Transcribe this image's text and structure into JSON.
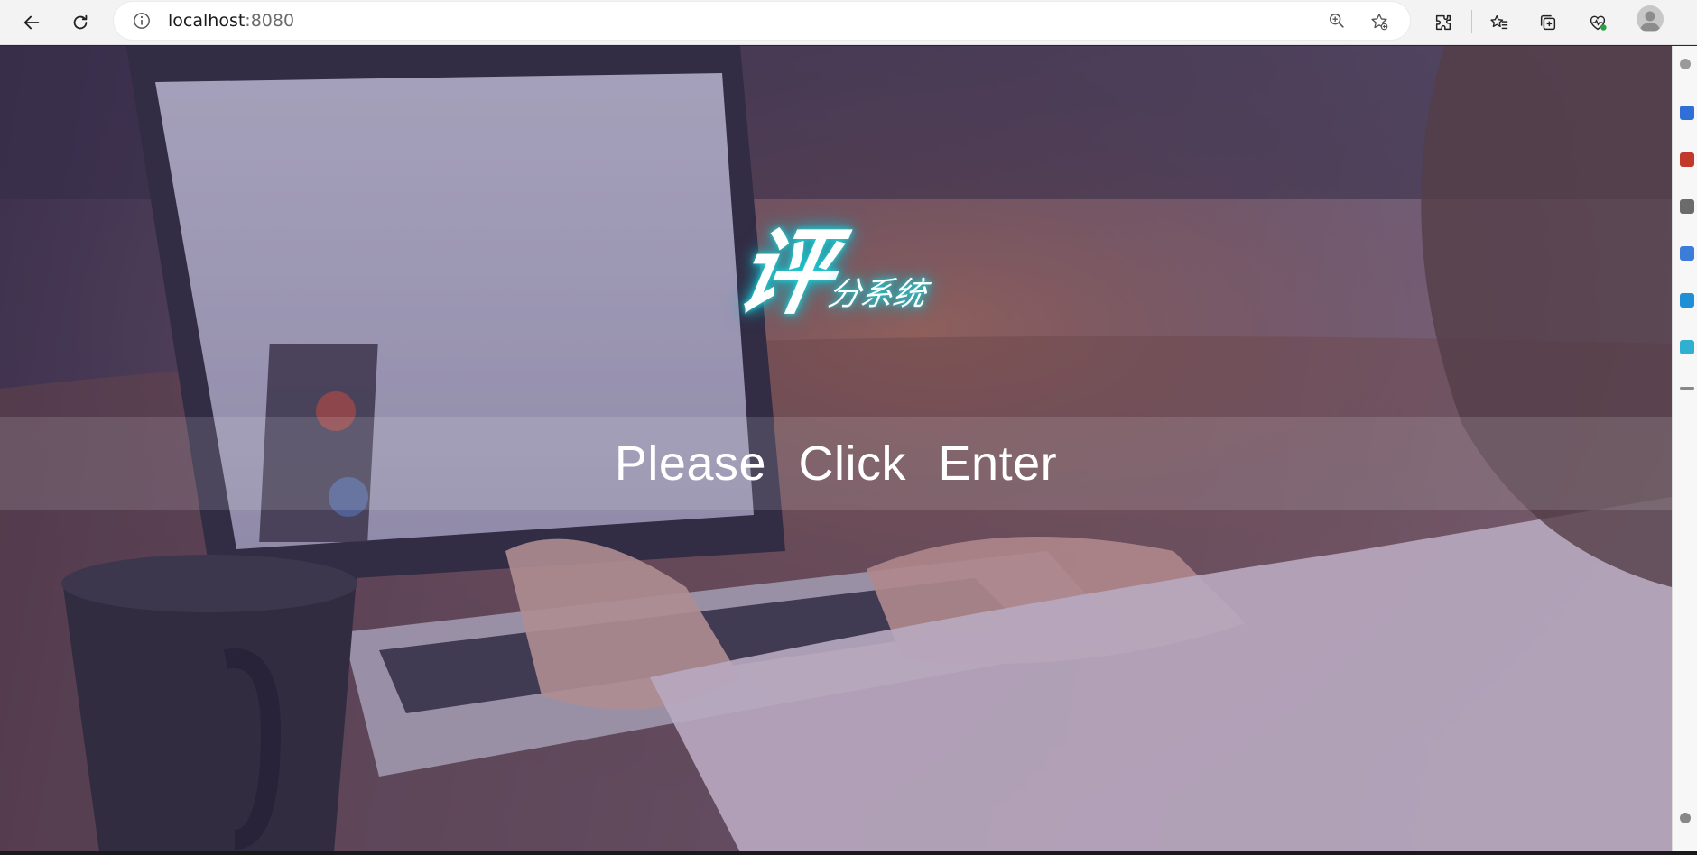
{
  "browser": {
    "url_host": "localhost",
    "url_port": ":8080",
    "icons": {
      "back": "back-arrow-icon",
      "refresh": "refresh-icon",
      "info": "site-info-icon",
      "zoom": "zoom-icon",
      "favorite": "add-favorite-icon",
      "extensions": "extensions-icon",
      "favorites": "favorites-icon",
      "collections": "collections-icon",
      "health": "browser-essentials-icon",
      "profile": "profile-avatar"
    }
  },
  "page": {
    "logo_big": "评",
    "logo_small": "分系统",
    "enter_text": "Please  Click  Enter"
  },
  "colors": {
    "overlay_tint": "#46346e",
    "logo_glow": "#20d6d6",
    "band": "#ffffff"
  }
}
